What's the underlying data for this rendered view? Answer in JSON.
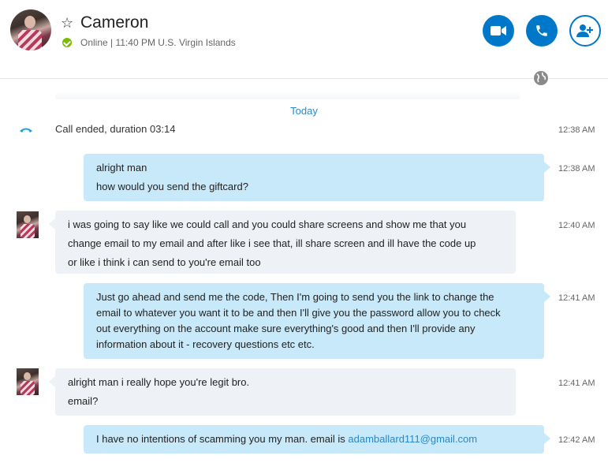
{
  "contact": {
    "name": "Cameron",
    "status": "Online | 11:40 PM U.S. Virgin Islands"
  },
  "header_buttons": {
    "video_icon": "video-camera-icon",
    "call_icon": "phone-icon",
    "add_icon": "add-person-icon"
  },
  "colors": {
    "accent": "#0078ca",
    "out_bubble": "#c7e9f9",
    "in_bubble": "#eef1f5",
    "online": "#7cbb00"
  },
  "chat": {
    "day_label": "Today",
    "call_event": {
      "text": "Call ended, duration 03:14",
      "time": "12:38 AM"
    },
    "messages": [
      {
        "dir": "out",
        "time": "12:38 AM",
        "lines": [
          "alright man",
          "how would you send the giftcard?"
        ]
      },
      {
        "dir": "in",
        "time": "12:40 AM",
        "lines": [
          "i was going to say like we could call and you could share screens and show me that you",
          "change email to my email and after like i see that, ill share screen and ill have the code up",
          "or like i think i can send to you're email too"
        ]
      },
      {
        "dir": "out",
        "time": "12:41 AM",
        "lines": [
          "Just go ahead and send me the code, Then I'm going to send you the link to change the",
          "email to whatever you want it to be and then I'll give you the password allow you to check",
          "out everything on the account make sure everything's good and then I'll provide any",
          "information about it - recovery questions etc etc."
        ]
      },
      {
        "dir": "in",
        "time": "12:41 AM",
        "lines": [
          "alright man i really hope you're legit bro.",
          "email?"
        ]
      },
      {
        "dir": "out",
        "time": "12:42 AM",
        "text": "I have no intentions of scamming you my man. email is ",
        "link": "adamballard111@gmail.com"
      }
    ]
  }
}
